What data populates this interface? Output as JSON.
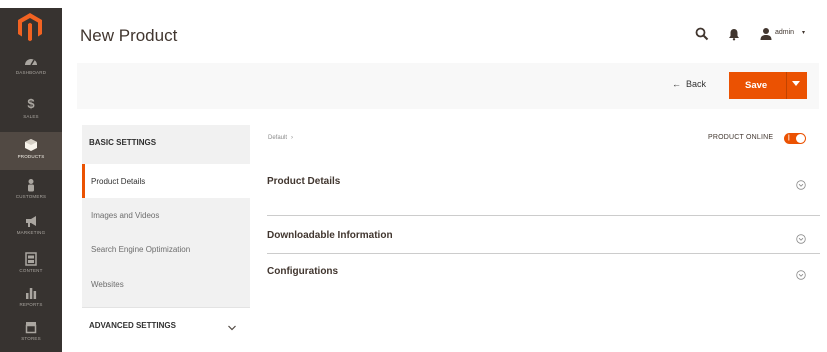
{
  "sidebar": {
    "items": [
      {
        "label": "DASHBOARD",
        "icon": "speedometer-icon",
        "active": false
      },
      {
        "label": "SALES",
        "icon": "dollar-icon",
        "active": false
      },
      {
        "label": "PRODUCTS",
        "icon": "cube-icon",
        "active": true
      },
      {
        "label": "CUSTOMERS",
        "icon": "person-icon",
        "active": false
      },
      {
        "label": "MARKETING",
        "icon": "megaphone-icon",
        "active": false
      },
      {
        "label": "CONTENT",
        "icon": "layout-icon",
        "active": false
      },
      {
        "label": "REPORTS",
        "icon": "bar-chart-icon",
        "active": false
      },
      {
        "label": "STORES",
        "icon": "store-icon",
        "active": false
      }
    ]
  },
  "header": {
    "title": "New Product",
    "user_label": "admin",
    "user_caret": "▾"
  },
  "actions": {
    "back_label": "Back",
    "back_arrow": "←",
    "save_label": "Save"
  },
  "tabs": {
    "basic_title": "BASIC SETTINGS",
    "links": [
      "Product Details",
      "Images and Videos",
      "Search Engine Optimization",
      "Websites"
    ],
    "advanced_title": "ADVANCED SETTINGS"
  },
  "content": {
    "breadcrumb": "Default",
    "breadcrumb_sep": "›",
    "online_label": "PRODUCT ONLINE",
    "sections": [
      "Product Details",
      "Downloadable Information",
      "Configurations"
    ]
  },
  "colors": {
    "accent": "#eb5202",
    "sidebar_bg": "#373330",
    "sidebar_active": "#514943"
  }
}
